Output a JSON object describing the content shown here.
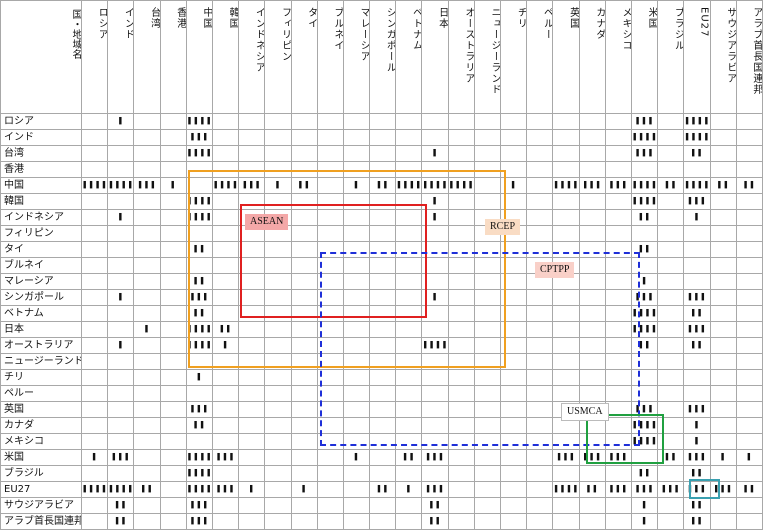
{
  "corner_label": "国・地域名",
  "columns": [
    "ロシア",
    "インド",
    "台湾",
    "香港",
    "中国",
    "韓国",
    "インドネシア",
    "フィリピン",
    "タイ",
    "ブルネイ",
    "マレーシア",
    "シンガポール",
    "ベトナム",
    "日本",
    "オーストラリア",
    "ニュージーランド",
    "チリ",
    "ペルー",
    "英国",
    "カナダ",
    "メキシコ",
    "米国",
    "ブラジル",
    "EU27",
    "サウジアラビア",
    "アラブ首長国連邦"
  ],
  "rows": [
    {
      "name": "ロシア",
      "cells": [
        "",
        "❚",
        "",
        "",
        "❚❚❚❚",
        "",
        "",
        "",
        "",
        "",
        "",
        "",
        "",
        "",
        "",
        "",
        "",
        "",
        "",
        "",
        "",
        "❚❚❚",
        "",
        "❚❚❚❚",
        "",
        ""
      ]
    },
    {
      "name": "インド",
      "cells": [
        "",
        "",
        "",
        "",
        "❚❚❚",
        "",
        "",
        "",
        "",
        "",
        "",
        "",
        "",
        "",
        "",
        "",
        "",
        "",
        "",
        "",
        "",
        "❚❚❚❚",
        "",
        "❚❚❚❚",
        "",
        ""
      ]
    },
    {
      "name": "台湾",
      "cells": [
        "",
        "",
        "",
        "",
        "❚❚❚❚",
        "",
        "",
        "",
        "",
        "",
        "",
        "",
        "",
        "❚",
        "",
        "",
        "",
        "",
        "",
        "",
        "",
        "❚❚❚",
        "",
        "❚❚",
        "",
        ""
      ]
    },
    {
      "name": "香港",
      "cells": [
        "",
        "",
        "",
        "",
        "",
        "",
        "",
        "",
        "",
        "",
        "",
        "",
        "",
        "",
        "",
        "",
        "",
        "",
        "",
        "",
        "",
        "",
        "",
        "",
        "",
        ""
      ]
    },
    {
      "name": "中国",
      "cells": [
        "❚❚❚❚",
        "❚❚❚❚",
        "❚❚❚",
        "❚",
        "",
        "❚❚❚❚",
        "❚❚❚",
        "❚",
        "❚❚",
        "",
        "❚",
        "❚❚",
        "❚❚❚❚",
        "❚❚❚❚",
        "❚❚❚❚",
        "",
        "❚",
        "",
        "❚❚❚❚",
        "❚❚❚",
        "❚❚❚",
        "❚❚❚❚",
        "❚❚",
        "❚❚❚❚",
        "❚❚",
        "❚❚"
      ]
    },
    {
      "name": "韓国",
      "cells": [
        "",
        "",
        "",
        "",
        "❚❚❚❚",
        "",
        "",
        "",
        "",
        "",
        "",
        "",
        "",
        "❚",
        "",
        "",
        "",
        "",
        "",
        "",
        "",
        "❚❚❚❚",
        "",
        "❚❚❚",
        "",
        ""
      ]
    },
    {
      "name": "インドネシア",
      "cells": [
        "",
        "❚",
        "",
        "",
        "❚❚❚❚",
        "",
        "",
        "",
        "",
        "",
        "",
        "",
        "",
        "❚",
        "",
        "",
        "",
        "",
        "",
        "",
        "",
        "❚❚",
        "",
        "❚",
        "",
        ""
      ]
    },
    {
      "name": "フィリピン",
      "cells": [
        "",
        "",
        "",
        "",
        "",
        "",
        "",
        "",
        "",
        "",
        "",
        "",
        "",
        "",
        "",
        "",
        "",
        "",
        "",
        "",
        "",
        "",
        "",
        "",
        "",
        ""
      ]
    },
    {
      "name": "タイ",
      "cells": [
        "",
        "",
        "",
        "",
        "❚❚",
        "",
        "",
        "",
        "",
        "",
        "",
        "",
        "",
        "",
        "",
        "",
        "",
        "",
        "",
        "",
        "",
        "❚❚",
        "",
        "",
        "",
        ""
      ]
    },
    {
      "name": "ブルネイ",
      "cells": [
        "",
        "",
        "",
        "",
        "",
        "",
        "",
        "",
        "",
        "",
        "",
        "",
        "",
        "",
        "",
        "",
        "",
        "",
        "",
        "",
        "",
        "",
        "",
        "",
        "",
        ""
      ]
    },
    {
      "name": "マレーシア",
      "cells": [
        "",
        "",
        "",
        "",
        "❚❚",
        "",
        "",
        "",
        "",
        "",
        "",
        "",
        "",
        "",
        "",
        "",
        "",
        "",
        "",
        "",
        "",
        "❚",
        "",
        "",
        "",
        ""
      ]
    },
    {
      "name": "シンガポール",
      "cells": [
        "",
        "❚",
        "",
        "",
        "❚❚❚",
        "",
        "",
        "",
        "",
        "",
        "",
        "",
        "",
        "❚",
        "",
        "",
        "",
        "",
        "",
        "",
        "",
        "❚❚❚",
        "",
        "❚❚❚",
        "",
        ""
      ]
    },
    {
      "name": "ベトナム",
      "cells": [
        "",
        "",
        "",
        "",
        "❚❚",
        "",
        "",
        "",
        "",
        "",
        "",
        "",
        "",
        "",
        "",
        "",
        "",
        "",
        "",
        "",
        "",
        "❚❚❚❚",
        "",
        "❚❚",
        "",
        ""
      ]
    },
    {
      "name": "日本",
      "cells": [
        "",
        "",
        "❚",
        "",
        "❚❚❚❚",
        "❚❚",
        "",
        "",
        "",
        "",
        "",
        "",
        "",
        "",
        "",
        "",
        "",
        "",
        "",
        "",
        "",
        "❚❚❚❚",
        "",
        "❚❚❚",
        "",
        ""
      ]
    },
    {
      "name": "オーストラリア",
      "cells": [
        "",
        "❚",
        "",
        "",
        "❚❚❚❚",
        "❚",
        "",
        "",
        "",
        "",
        "",
        "",
        "",
        "❚❚❚❚",
        "",
        "",
        "",
        "",
        "",
        "",
        "",
        "❚❚",
        "",
        "❚❚",
        "",
        ""
      ]
    },
    {
      "name": "ニュージーランド",
      "cells": [
        "",
        "",
        "",
        "",
        "",
        "",
        "",
        "",
        "",
        "",
        "",
        "",
        "",
        "",
        "",
        "",
        "",
        "",
        "",
        "",
        "",
        "",
        "",
        "",
        "",
        ""
      ]
    },
    {
      "name": "チリ",
      "cells": [
        "",
        "",
        "",
        "",
        "❚",
        "",
        "",
        "",
        "",
        "",
        "",
        "",
        "",
        "",
        "",
        "",
        "",
        "",
        "",
        "",
        "",
        "",
        "",
        "",
        "",
        ""
      ]
    },
    {
      "name": "ペルー",
      "cells": [
        "",
        "",
        "",
        "",
        "",
        "",
        "",
        "",
        "",
        "",
        "",
        "",
        "",
        "",
        "",
        "",
        "",
        "",
        "",
        "",
        "",
        "",
        "",
        "",
        "",
        ""
      ]
    },
    {
      "name": "英国",
      "cells": [
        "",
        "",
        "",
        "",
        "❚❚❚",
        "",
        "",
        "",
        "",
        "",
        "",
        "",
        "",
        "",
        "",
        "",
        "",
        "",
        "",
        "",
        "",
        "❚❚❚",
        "",
        "❚❚❚",
        "",
        ""
      ]
    },
    {
      "name": "カナダ",
      "cells": [
        "",
        "",
        "",
        "",
        "❚❚",
        "",
        "",
        "",
        "",
        "",
        "",
        "",
        "",
        "",
        "",
        "",
        "",
        "",
        "",
        "",
        "",
        "❚❚❚❚",
        "",
        "❚",
        "",
        ""
      ]
    },
    {
      "name": "メキシコ",
      "cells": [
        "",
        "",
        "",
        "",
        "",
        "",
        "",
        "",
        "",
        "",
        "",
        "",
        "",
        "",
        "",
        "",
        "",
        "",
        "",
        "",
        "",
        "❚❚❚❚",
        "",
        "❚",
        "",
        ""
      ]
    },
    {
      "name": "米国",
      "cells": [
        "❚",
        "❚❚❚",
        "",
        "",
        "❚❚❚❚",
        "❚❚❚",
        "",
        "",
        "",
        "",
        "❚",
        "",
        "❚❚",
        "❚❚❚",
        "",
        "",
        "",
        "",
        "❚❚❚",
        "❚❚❚",
        "❚❚❚",
        "",
        "❚❚",
        "❚❚❚",
        "❚",
        "❚"
      ]
    },
    {
      "name": "ブラジル",
      "cells": [
        "",
        "",
        "",
        "",
        "❚❚❚❚",
        "",
        "",
        "",
        "",
        "",
        "",
        "",
        "",
        "",
        "",
        "",
        "",
        "",
        "",
        "",
        "",
        "❚❚",
        "",
        "❚❚",
        "",
        ""
      ]
    },
    {
      "name": "EU27",
      "cells": [
        "❚❚❚❚",
        "❚❚❚❚",
        "❚❚",
        "",
        "❚❚❚❚",
        "❚❚❚",
        "❚",
        "",
        "❚",
        "",
        "",
        "❚❚",
        "❚",
        "❚❚❚",
        "",
        "",
        "",
        "",
        "❚❚❚❚",
        "❚❚",
        "❚❚❚",
        "❚❚❚",
        "❚❚❚",
        "❚❚❚",
        "❚❚❚",
        "❚❚"
      ]
    },
    {
      "name": "サウジアラビア",
      "cells": [
        "",
        "❚❚",
        "",
        "",
        "❚❚❚",
        "",
        "",
        "",
        "",
        "",
        "",
        "",
        "",
        "❚❚",
        "",
        "",
        "",
        "",
        "",
        "",
        "",
        "❚",
        "",
        "❚❚",
        "",
        ""
      ]
    },
    {
      "name": "アラブ首長国連邦",
      "cells": [
        "",
        "❚❚",
        "",
        "",
        "❚❚❚",
        "",
        "",
        "",
        "",
        "",
        "",
        "",
        "",
        "❚❚",
        "",
        "",
        "",
        "",
        "",
        "",
        "",
        "❚",
        "",
        "❚❚",
        "",
        ""
      ]
    }
  ],
  "annotations": [
    {
      "id": "asean",
      "label": "ASEAN",
      "color": "#e02020",
      "label_bg": "#f4a8a8"
    },
    {
      "id": "rcep",
      "label": "RCEP",
      "color": "#f0a020",
      "label_bg": "#f9dcc4"
    },
    {
      "id": "cptpp",
      "label": "CPTPP",
      "color": "#1f2fd8",
      "label_bg": "#f9d0c8"
    },
    {
      "id": "usmca",
      "label": "USMCA",
      "color": "#20a040",
      "label_bg": "#ffffff"
    },
    {
      "id": "eu",
      "label": "",
      "color": "#3aa0b0",
      "label_bg": ""
    }
  ]
}
